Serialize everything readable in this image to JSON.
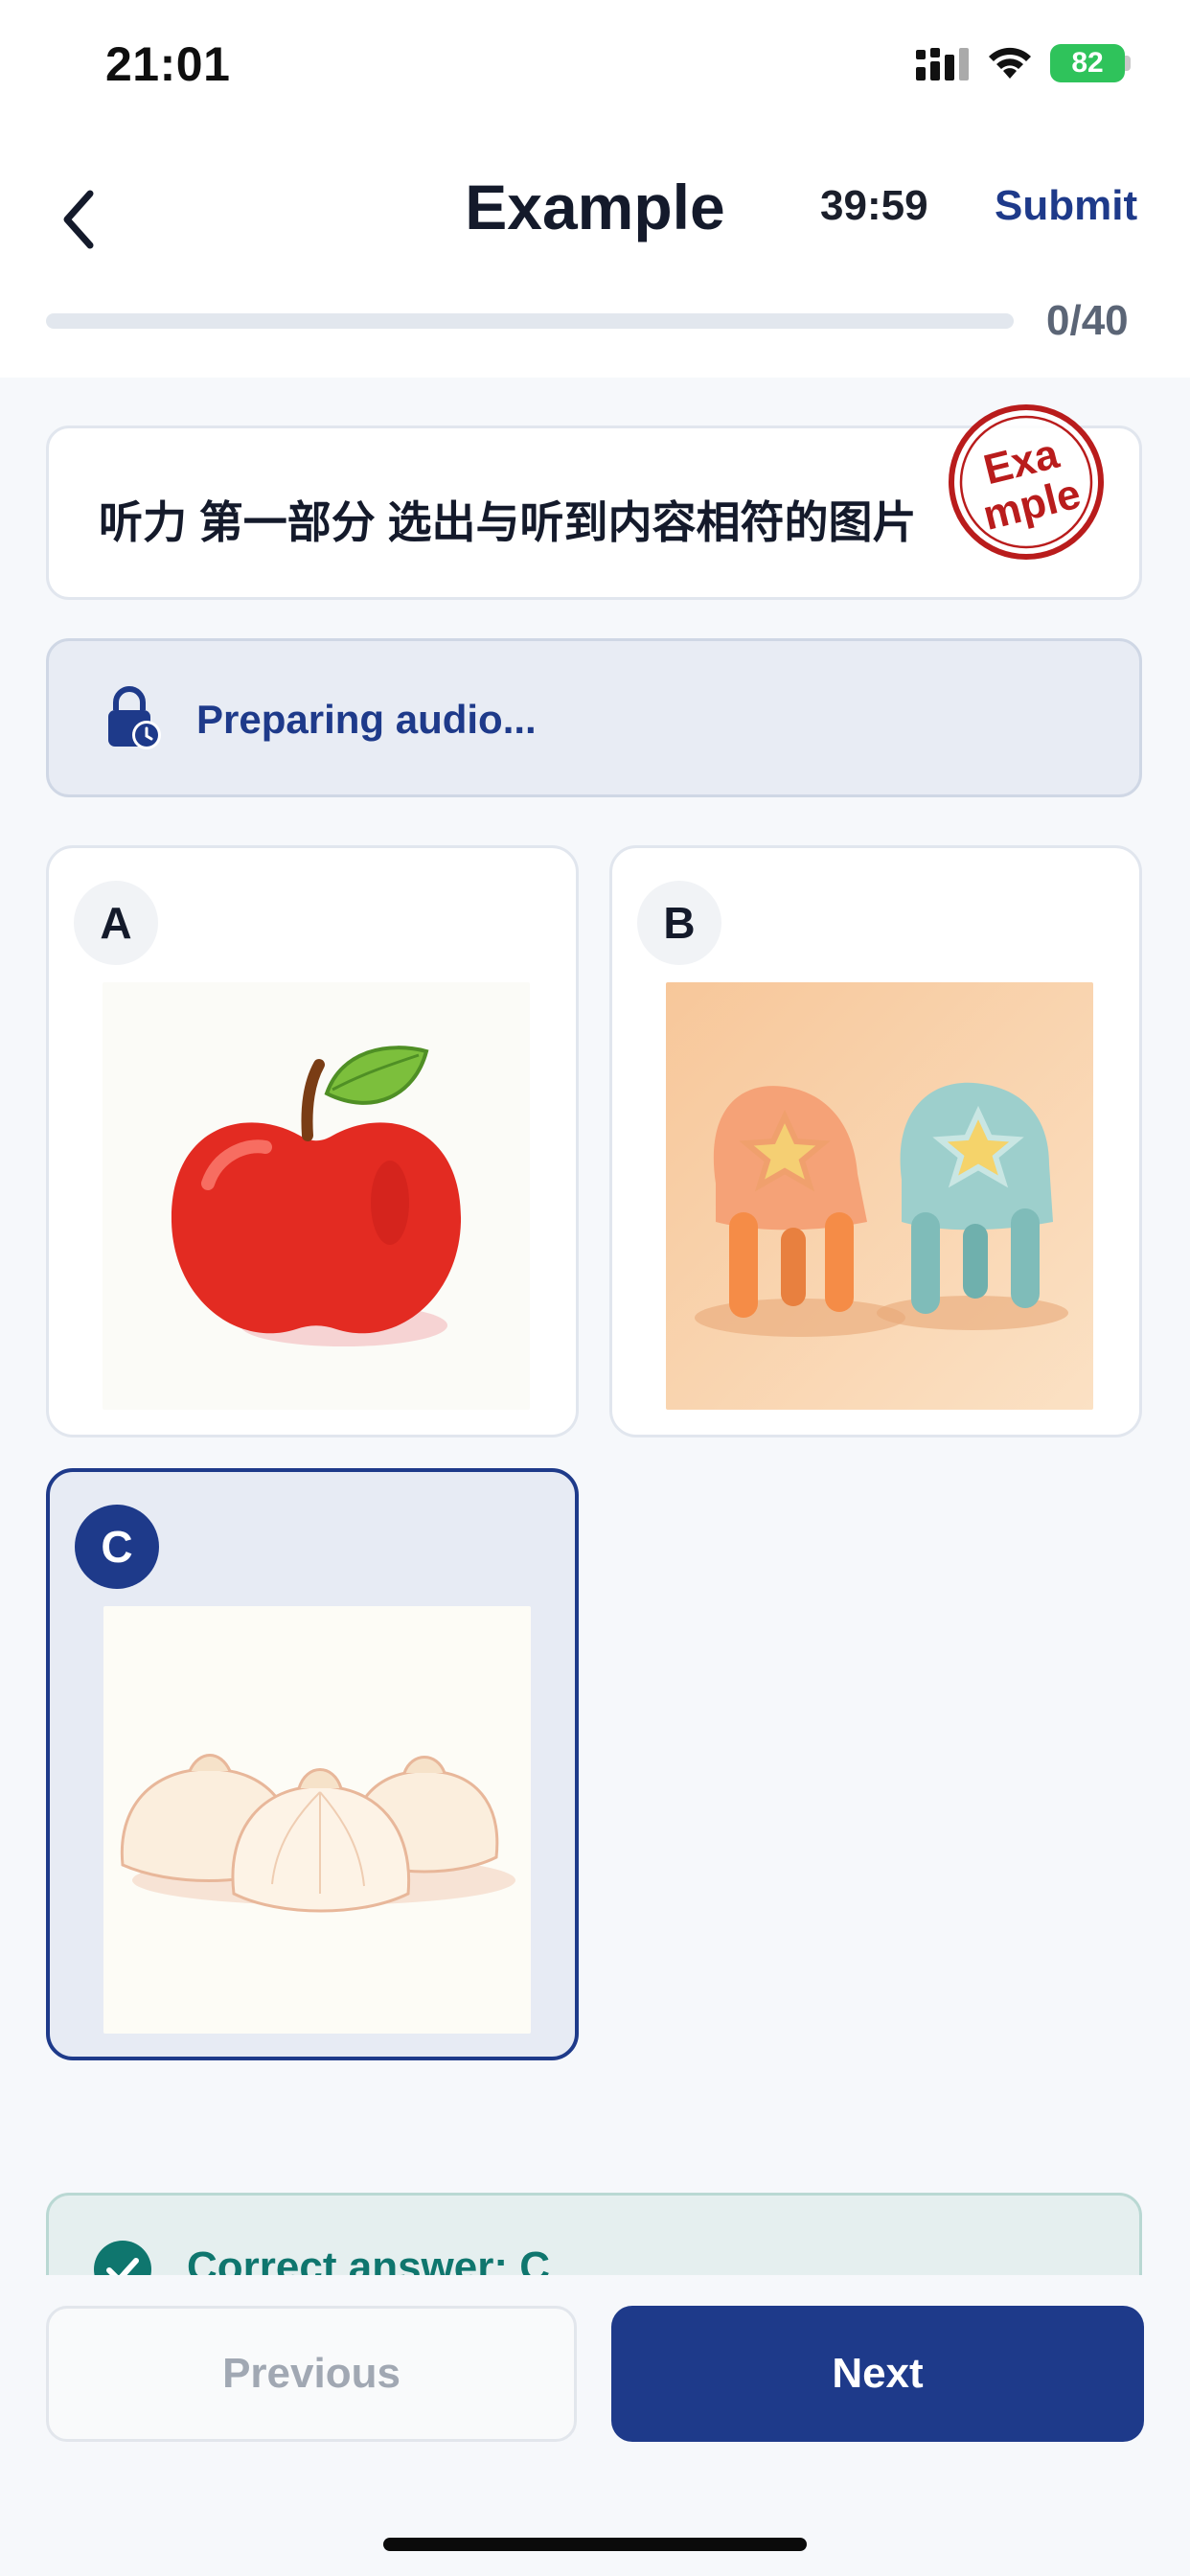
{
  "status_bar": {
    "time": "21:01",
    "battery": "82"
  },
  "header": {
    "back_icon": "chevron-left-icon",
    "title": "Example",
    "timer": "39:59",
    "submit_label": "Submit",
    "progress_text": "0/40",
    "progress_fraction": 0
  },
  "question": {
    "text": "听力 第一部分 选出与听到内容相符的图片",
    "stamp_text": "Example"
  },
  "audio": {
    "icon": "lock-clock-icon",
    "status": "Preparing audio..."
  },
  "options": [
    {
      "label": "A",
      "image": "red apple",
      "selected": false
    },
    {
      "label": "B",
      "image": "two toy chairs with star cushions",
      "selected": false
    },
    {
      "label": "C",
      "image": "steamed buns",
      "selected": true
    }
  ],
  "answer": {
    "icon": "check-circle-icon",
    "text": "Correct answer: C"
  },
  "footer": {
    "previous_label": "Previous",
    "next_label": "Next"
  },
  "colors": {
    "accent": "#1e3a8a",
    "correct": "#0f766e"
  }
}
